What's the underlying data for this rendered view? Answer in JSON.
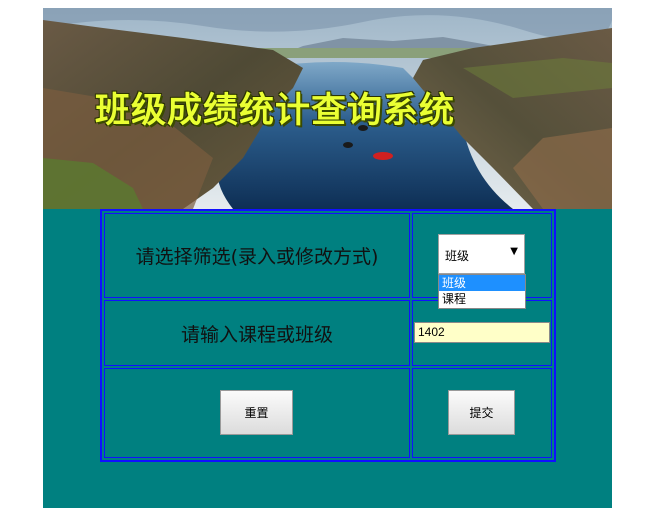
{
  "banner": {
    "title": "班级成绩统计查询系统"
  },
  "form": {
    "filter_label": "请选择筛选(录入或修改方式)",
    "select_value": "班级",
    "options": [
      "班级",
      "课程"
    ],
    "input_label": "请输入课程或班级",
    "input_value": "1402",
    "reset_label": "重置",
    "submit_label": "提交"
  },
  "colors": {
    "panel": "#008080",
    "border": "#1010ff",
    "title": "#eaff33",
    "input_bg": "#ffffc8",
    "option_highlight": "#1e90ff"
  }
}
